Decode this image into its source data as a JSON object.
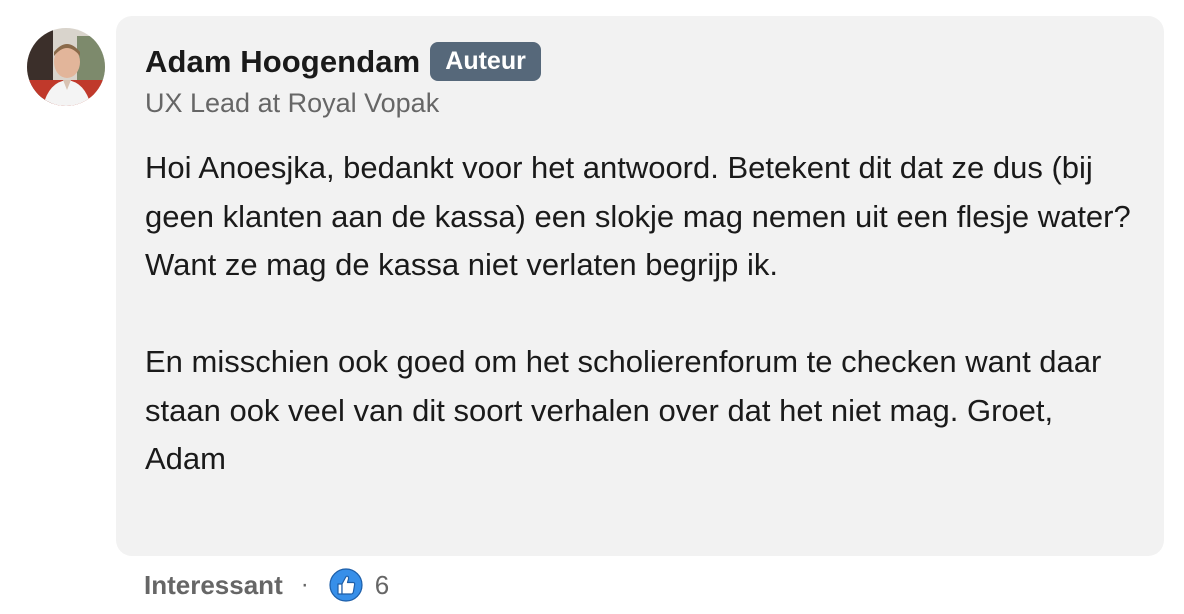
{
  "author": {
    "name": "Adam Hoogendam",
    "badge": "Auteur",
    "headline": "UX Lead at Royal Vopak"
  },
  "comment": {
    "paragraphs": [
      "Hoi Anoesjka, bedankt voor het antwoord. Betekent dit dat ze dus (bij geen klanten aan de kassa) een slokje mag nemen uit een flesje water? Want ze mag de kassa niet verlaten begrijp ik.",
      "En misschien ook goed om het scholierenforum te checken want daar staan ook veel van dit soort verhalen over dat het niet mag. Groet, Adam"
    ]
  },
  "footer": {
    "reaction_label": "Interessant",
    "separator": "·",
    "reaction_icon": "thumbs-up-icon",
    "reaction_count": "6"
  },
  "colors": {
    "bubble": "#f2f2f2",
    "badge": "#56687a",
    "text": "#1a1a1a",
    "muted": "#666666",
    "like_blue": "#378fe9"
  }
}
